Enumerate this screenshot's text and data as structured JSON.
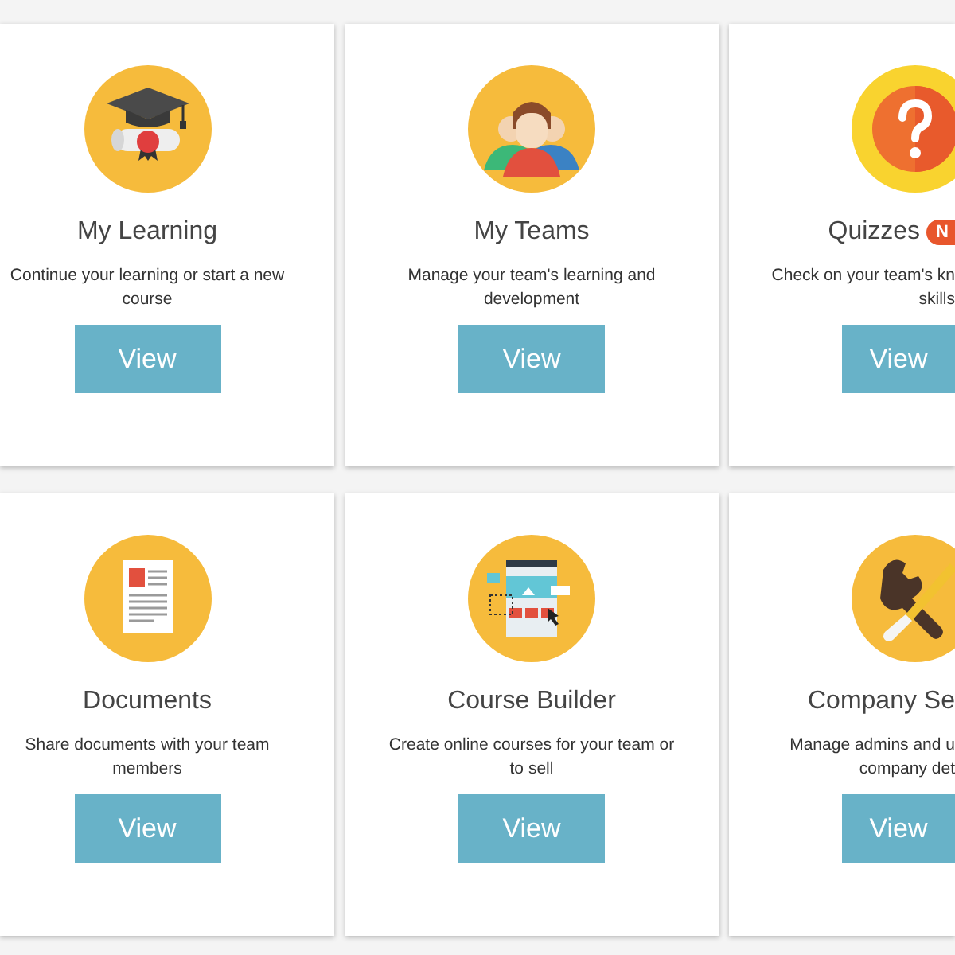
{
  "cards": [
    {
      "kind": "graduation",
      "title": "My Learning",
      "description": "Continue your learning or start a new\ncourse",
      "button": "View"
    },
    {
      "kind": "team",
      "title": "My Teams",
      "description": "Manage your team's learning and\ndevelopment",
      "button": "View"
    },
    {
      "kind": "question",
      "title": "Quizzes",
      "badge": "N",
      "description": "Check on your team's kn\nskills",
      "button": "View"
    },
    {
      "kind": "document",
      "title": "Documents",
      "description": "Share documents with your team\nmembers",
      "button": "View"
    },
    {
      "kind": "builder",
      "title": "Course Builder",
      "description": "Create online courses for your team or\nto sell",
      "button": "View"
    },
    {
      "kind": "tools",
      "title": "Company Se",
      "description": "Manage admins and u\ncompany det",
      "button": "View"
    }
  ]
}
